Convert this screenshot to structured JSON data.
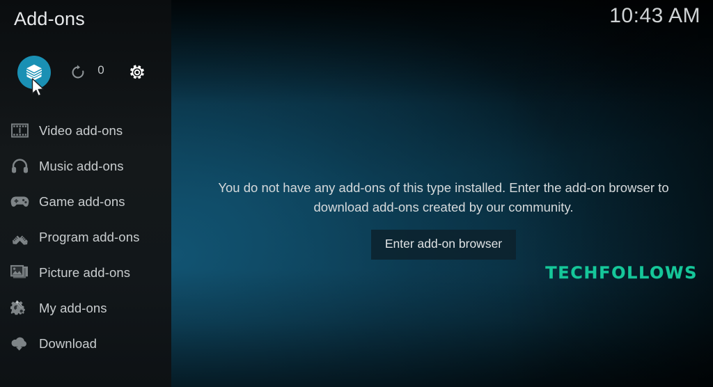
{
  "window": {
    "title": "Add-ons",
    "clock": "10:43 AM"
  },
  "colors": {
    "accent": "#1a90b4",
    "sidebar_bg": "#14181a",
    "main_gradient_from": "#0c4258",
    "main_gradient_to": "#020f16",
    "menu_text": "#c9cdcf",
    "watermark": "#16c79a"
  },
  "toolbar": {
    "items": [
      {
        "name": "addon-browser-icon",
        "label": "Add-on browser",
        "selected": true
      },
      {
        "name": "check-updates-icon",
        "label": "Check for updates",
        "selected": false
      },
      {
        "name": "settings-gear-icon",
        "label": "Settings",
        "selected": false
      }
    ],
    "update_count": "0"
  },
  "sidebar": {
    "items": [
      {
        "icon": "film-strip-icon",
        "label": "Video add-ons"
      },
      {
        "icon": "headphones-icon",
        "label": "Music add-ons"
      },
      {
        "icon": "gamepad-icon",
        "label": "Game add-ons"
      },
      {
        "icon": "pencil-ruler-icon",
        "label": "Program add-ons"
      },
      {
        "icon": "picture-icon",
        "label": "Picture add-ons"
      },
      {
        "icon": "gears-tool-icon",
        "label": "My add-ons"
      },
      {
        "icon": "download-cloud-icon",
        "label": "Download"
      }
    ]
  },
  "main": {
    "empty_message": "You do not have any add-ons of this type installed. Enter the add-on browser to download add-ons created by our community.",
    "enter_browser_label": "Enter add-on browser"
  },
  "watermark": {
    "text": "TECHFOLLOWS"
  }
}
